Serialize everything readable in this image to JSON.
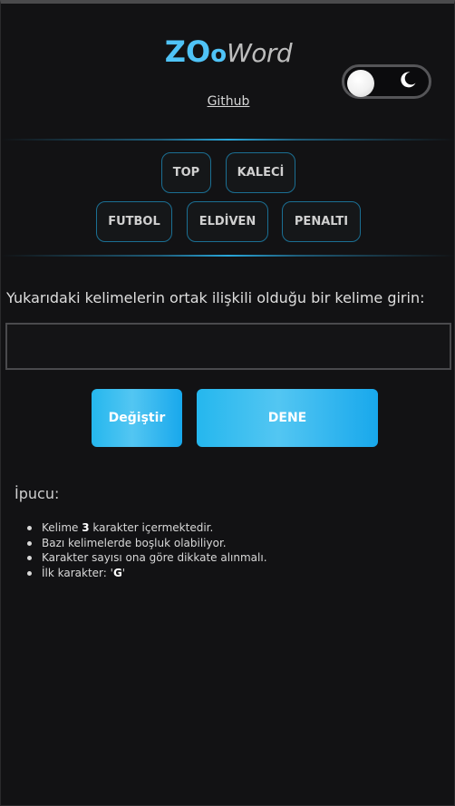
{
  "header": {
    "logo": {
      "part_z": "Z",
      "part_o1": "O",
      "part_o2": "o",
      "part_word": "Word"
    },
    "github_link": "Github",
    "theme_toggle": {
      "mode": "dark",
      "icon": "moon-icon"
    }
  },
  "clue_words": {
    "row1": [
      "TOP",
      "KALECİ"
    ],
    "row2": [
      "FUTBOL",
      "ELDİVEN",
      "PENALTI"
    ]
  },
  "prompt": "Yukarıdaki kelimelerin ortak ilişkili olduğu bir kelime girin:",
  "answer_input": {
    "value": "",
    "placeholder": ""
  },
  "buttons": {
    "change_label": "Değiştir",
    "try_label": "DENE"
  },
  "hint": {
    "title": "İpucu:",
    "items": {
      "item1_pre": "Kelime ",
      "item1_num": "3",
      "item1_post": " karakter içermektedir.",
      "item2": "Bazı kelimelerde boşluk olabiliyor.",
      "item3": "Karakter sayısı ona göre dikkate alınmalı.",
      "item4_pre": "İlk karakter: '",
      "item4_char": "G",
      "item4_post": "'"
    }
  },
  "colors": {
    "accent": "#4fc3f7",
    "button": "#25b7ee",
    "background": "#121214",
    "chip_border": "#1b6f93"
  }
}
